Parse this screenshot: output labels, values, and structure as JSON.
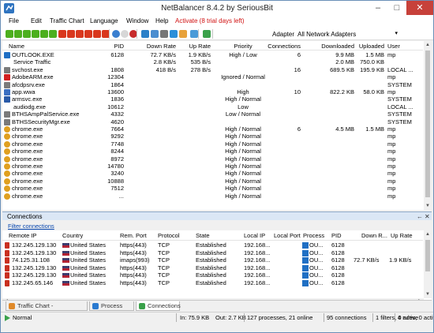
{
  "window": {
    "title": "NetBalancer 8.4.2 by SeriousBit",
    "min_icon": "minimize-icon",
    "max_icon": "maximize-icon",
    "close_icon": "close-icon",
    "min_glyph": "–",
    "max_glyph": "□",
    "close_glyph": "✕"
  },
  "menu": [
    "File",
    "Edit",
    "Traffic Chart",
    "Language",
    "Window",
    "Help"
  ],
  "trial_text": "Activate (8 trial days left)",
  "toolbar": {
    "adapter_label": "Adapter",
    "adapter_value": "All Network Adapters",
    "adapter_caret": "▾",
    "icons": [
      "dl-limit-icon",
      "dl-limit-2-icon",
      "dl-priority-icon",
      "dl-ignore-icon",
      "dl-block-icon",
      "dl-normal-icon",
      "ul-limit-icon",
      "ul-limit-2-icon",
      "ul-priority-icon",
      "ul-ignore-icon",
      "ul-block-icon",
      "ul-normal-icon",
      "refresh-icon",
      "forward-icon",
      "reset-icon",
      "traffic-chart-icon",
      "process-view-icon",
      "rules-icon",
      "filter-icon",
      "settings-icon",
      "sync-icon",
      "checkbox-icon"
    ],
    "icon_colors": [
      "#4caf1e",
      "#4caf1e",
      "#4caf1e",
      "#4caf1e",
      "#4caf1e",
      "#4caf1e",
      "#d9371d",
      "#d9371d",
      "#d9371d",
      "#d9371d",
      "#d9371d",
      "#d9371d",
      "#3a7fd0",
      "#d7d7d7",
      "#c72c2c",
      "#2c80c8",
      "#4a8dd0",
      "#777777",
      "#2c8fd9",
      "#e8a23a",
      "#4a9ad8",
      "#3aa14a"
    ]
  },
  "processes": {
    "columns": [
      "Name",
      "PID",
      "Down Rate",
      "Up Rate",
      "Priority",
      "Connections",
      "Downloaded",
      "Uploaded",
      "User"
    ],
    "rows": [
      {
        "icon": "outlook-icon",
        "color": "#1f6fc4",
        "name": "OUTLOOK.EXE",
        "pid": "6128",
        "down": "72.7 KB/s",
        "up": "1.9 KB/s",
        "priority": "High / Low",
        "conns": "6",
        "downloaded": "9.9 MB",
        "uploaded": "1.5 MB",
        "user": "mp"
      },
      {
        "icon": "",
        "color": "",
        "name": "Service Traffic",
        "pid": "",
        "down": "2.8 KB/s",
        "up": "535 B/s",
        "priority": "",
        "conns": "",
        "downloaded": "2.0 MB",
        "uploaded": "750.0 KB",
        "user": "",
        "indent": true
      },
      {
        "icon": "svchost-icon",
        "color": "#7a7a7a",
        "name": "svchost.exe",
        "pid": "1808",
        "down": "418 B/s",
        "up": "278 B/s",
        "priority": "",
        "conns": "16",
        "downloaded": "689.5 KB",
        "uploaded": "195.9 KB",
        "user": "LOCAL ..."
      },
      {
        "icon": "adobe-icon",
        "color": "#d22020",
        "name": "AdobeARM.exe",
        "pid": "12304",
        "down": "",
        "up": "",
        "priority": "Ignored / Normal",
        "conns": "",
        "downloaded": "",
        "uploaded": "",
        "user": "mp"
      },
      {
        "icon": "app-icon",
        "color": "#7a7a7a",
        "name": "afcdpsrv.exe",
        "pid": "1864",
        "down": "",
        "up": "",
        "priority": "",
        "conns": "",
        "downloaded": "",
        "uploaded": "",
        "user": "SYSTEM"
      },
      {
        "icon": "app-icon",
        "color": "#3b6fc2",
        "name": "app.wwa",
        "pid": "13600",
        "down": "",
        "up": "",
        "priority": "High",
        "conns": "10",
        "downloaded": "822.2 KB",
        "uploaded": "58.0 KB",
        "user": "mp"
      },
      {
        "icon": "window-icon",
        "color": "#2a5aa8",
        "name": "armsvc.exe",
        "pid": "1836",
        "down": "",
        "up": "",
        "priority": "High / Normal",
        "conns": "",
        "downloaded": "",
        "uploaded": "",
        "user": "SYSTEM"
      },
      {
        "icon": "",
        "color": "",
        "name": "audiodg.exe",
        "pid": "10612",
        "down": "",
        "up": "",
        "priority": "Low",
        "conns": "",
        "downloaded": "",
        "uploaded": "",
        "user": "LOCAL ...",
        "indent": true
      },
      {
        "icon": "app-icon",
        "color": "#7a7a7a",
        "name": "BTHSAmpPalService.exe",
        "pid": "4332",
        "down": "",
        "up": "",
        "priority": "Low / Normal",
        "conns": "",
        "downloaded": "",
        "uploaded": "",
        "user": "SYSTEM"
      },
      {
        "icon": "app-icon",
        "color": "#7a7a7a",
        "name": "BTHSSecurityMgr.exe",
        "pid": "4620",
        "down": "",
        "up": "",
        "priority": "",
        "conns": "",
        "downloaded": "",
        "uploaded": "",
        "user": "SYSTEM"
      },
      {
        "icon": "chrome-icon",
        "color": "#e0a020",
        "name": "chrome.exe",
        "pid": "7664",
        "down": "",
        "up": "",
        "priority": "High / Normal",
        "conns": "6",
        "downloaded": "4.5 MB",
        "uploaded": "1.5 MB",
        "user": "mp"
      },
      {
        "icon": "chrome-icon",
        "color": "#e0a020",
        "name": "chrome.exe",
        "pid": "9292",
        "down": "",
        "up": "",
        "priority": "High / Normal",
        "conns": "",
        "downloaded": "",
        "uploaded": "",
        "user": "mp"
      },
      {
        "icon": "chrome-icon",
        "color": "#e0a020",
        "name": "chrome.exe",
        "pid": "7748",
        "down": "",
        "up": "",
        "priority": "High / Normal",
        "conns": "",
        "downloaded": "",
        "uploaded": "",
        "user": "mp"
      },
      {
        "icon": "chrome-icon",
        "color": "#e0a020",
        "name": "chrome.exe",
        "pid": "8244",
        "down": "",
        "up": "",
        "priority": "High / Normal",
        "conns": "",
        "downloaded": "",
        "uploaded": "",
        "user": "mp"
      },
      {
        "icon": "chrome-icon",
        "color": "#e0a020",
        "name": "chrome.exe",
        "pid": "8972",
        "down": "",
        "up": "",
        "priority": "High / Normal",
        "conns": "",
        "downloaded": "",
        "uploaded": "",
        "user": "mp"
      },
      {
        "icon": "chrome-icon",
        "color": "#e0a020",
        "name": "chrome.exe",
        "pid": "14780",
        "down": "",
        "up": "",
        "priority": "High / Normal",
        "conns": "",
        "downloaded": "",
        "uploaded": "",
        "user": "mp"
      },
      {
        "icon": "chrome-icon",
        "color": "#e0a020",
        "name": "chrome.exe",
        "pid": "3240",
        "down": "",
        "up": "",
        "priority": "High / Normal",
        "conns": "",
        "downloaded": "",
        "uploaded": "",
        "user": "mp"
      },
      {
        "icon": "chrome-icon",
        "color": "#e0a020",
        "name": "chrome.exe",
        "pid": "10888",
        "down": "",
        "up": "",
        "priority": "High / Normal",
        "conns": "",
        "downloaded": "",
        "uploaded": "",
        "user": "mp"
      },
      {
        "icon": "chrome-icon",
        "color": "#e0a020",
        "name": "chrome.exe",
        "pid": "7512",
        "down": "",
        "up": "",
        "priority": "High / Normal",
        "conns": "",
        "downloaded": "",
        "uploaded": "",
        "user": "mp"
      },
      {
        "icon": "chrome-icon",
        "color": "#e0a020",
        "name": "chrome.exe",
        "pid": "...",
        "down": "",
        "up": "",
        "priority": "High / Normal",
        "conns": "",
        "downloaded": "",
        "uploaded": "",
        "user": "mp"
      }
    ]
  },
  "connections_panel": {
    "title": "Connections",
    "pin_icon": "pin-icon",
    "close_icon": "close-icon",
    "pin_glyph": "←",
    "close_glyph": "✕",
    "filter_link": "Filter connections",
    "columns": [
      "Remote IP",
      "Country",
      "Rem. Port",
      "Protocol",
      "State",
      "Local IP",
      "Local Port",
      "Process",
      "PID",
      "Down R...",
      "Up Rate"
    ],
    "rows": [
      {
        "remote": "132.245.129.130",
        "country": "United States",
        "port": "https(443)",
        "proto": "TCP",
        "state": "Established",
        "local": "192.168...",
        "lport": "",
        "process": "OU...",
        "pid": "6128",
        "down": "",
        "up": ""
      },
      {
        "remote": "132.245.129.130",
        "country": "United States",
        "port": "https(443)",
        "proto": "TCP",
        "state": "Established",
        "local": "192.168...",
        "lport": "",
        "process": "OU...",
        "pid": "6128",
        "down": "",
        "up": ""
      },
      {
        "remote": "74.125.31.108",
        "country": "United States",
        "port": "imaps(993)",
        "proto": "TCP",
        "state": "Established",
        "local": "192.168...",
        "lport": "",
        "process": "OU...",
        "pid": "6128",
        "down": "72.7 KB/s",
        "up": "1.9 KB/s"
      },
      {
        "remote": "132.245.129.130",
        "country": "United States",
        "port": "https(443)",
        "proto": "TCP",
        "state": "Established",
        "local": "192.168...",
        "lport": "",
        "process": "OU...",
        "pid": "6128",
        "down": "",
        "up": ""
      },
      {
        "remote": "132.245.129.130",
        "country": "United States",
        "port": "https(443)",
        "proto": "TCP",
        "state": "Established",
        "local": "192.168...",
        "lport": "",
        "process": "OU...",
        "pid": "6128",
        "down": "",
        "up": ""
      },
      {
        "remote": "132.245.65.146",
        "country": "United States",
        "port": "https(443)",
        "proto": "TCP",
        "state": "Established",
        "local": "192.168...",
        "lport": "",
        "process": "OU...",
        "pid": "6128",
        "down": "",
        "up": ""
      }
    ]
  },
  "tabs": [
    {
      "label": "Traffic Chart - NetBalancer",
      "icon": "chart-icon",
      "color": "#e08a2a"
    },
    {
      "label": "Process Info",
      "icon": "info-icon",
      "color": "#2a7ad0"
    },
    {
      "label": "Connections",
      "icon": "connections-icon",
      "color": "#3aa14a"
    }
  ],
  "status": {
    "mode": "Normal",
    "in": "In: 75.9 KB",
    "out": "Out: 2.7 KB",
    "processes": "127 processes, 21 online",
    "connections": "95 connections",
    "filters": "1 filters, 0 active",
    "rules": "4 rules, 0 active"
  }
}
